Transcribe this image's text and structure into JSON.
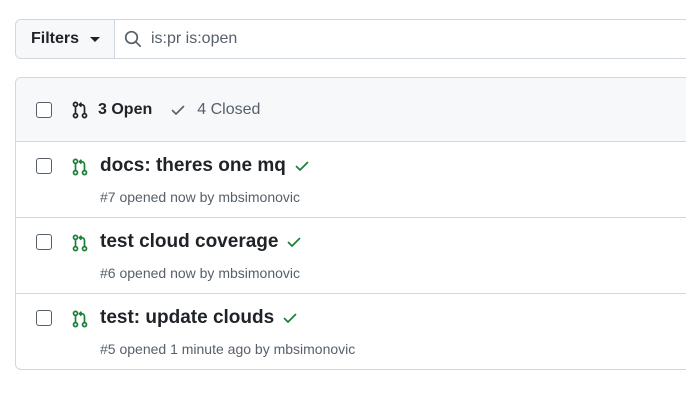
{
  "filter_bar": {
    "filters_label": "Filters",
    "search_value": "is:pr is:open"
  },
  "list_header": {
    "open_label": "3 Open",
    "closed_label": "4 Closed"
  },
  "pull_requests": [
    {
      "title": "docs: theres one mq",
      "meta": "#7 opened now by mbsimonovic",
      "status": "success"
    },
    {
      "title": "test cloud coverage",
      "meta": "#6 opened now by mbsimonovic",
      "status": "success"
    },
    {
      "title": "test: update clouds",
      "meta": "#5 opened 1 minute ago by mbsimonovic",
      "status": "success"
    }
  ],
  "colors": {
    "open_green": "#1a7f37",
    "check_green": "#1a7f37",
    "border": "#d0d7de",
    "header_bg": "#f6f8fa"
  },
  "icons": {
    "filters_caret": "caret-down-icon",
    "search": "search-icon",
    "pull_request": "git-pull-request-icon",
    "closed_check": "check-icon",
    "status_check": "check-icon"
  }
}
